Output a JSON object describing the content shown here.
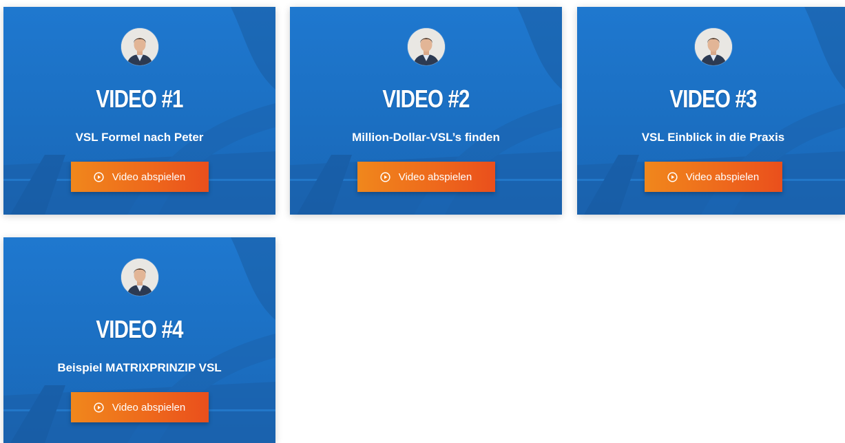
{
  "cards": [
    {
      "title": "VIDEO #1",
      "subtitle": "VSL Formel nach Peter",
      "button_label": "Video abspielen"
    },
    {
      "title": "VIDEO #2",
      "subtitle": "Million-Dollar-VSL’s finden",
      "button_label": "Video abspielen"
    },
    {
      "title": "VIDEO #3",
      "subtitle": "VSL Einblick in die Praxis",
      "button_label": "Video abspielen"
    },
    {
      "title": "VIDEO #4",
      "subtitle": "Beispiel MATRIXPRINZIP VSL",
      "button_label": "Video abspielen"
    }
  ],
  "icons": {
    "avatar": "avatar",
    "play": "play-circle-icon"
  },
  "colors": {
    "card_blue": "#1f78cf",
    "button_orange_start": "#f0871c",
    "button_orange_end": "#ea4f1c",
    "text": "#ffffff"
  }
}
